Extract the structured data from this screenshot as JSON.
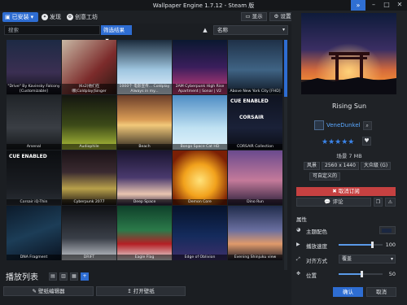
{
  "window": {
    "title": "Wallpaper Engine 1.7.12 - Steam 版"
  },
  "tabs": {
    "installed": "已安装",
    "discover": "发现",
    "workshop": "创意工坊"
  },
  "toolbar": {
    "display": "显示",
    "settings": "设置"
  },
  "search": {
    "placeholder": "搜索"
  },
  "filter": {
    "label": "筛选结果"
  },
  "sort": {
    "value": "名称"
  },
  "grid": {
    "items": [
      "\"Drive\" By Kavinsky Falcony [Customizable]",
      "(Ks2)他们在哪|Coldplay|Singer",
      "1000个 电影宣传... Coldplay Always in my...",
      "2AM Cyberpunk High Rise Apartment | Sonar | V2",
      "Above New York City [FHD]",
      "Arsenal",
      "Audiophile",
      "Beach",
      "Bongo Space Cat HD",
      "CORSAIR Collection",
      "Corsair iQ-Thin",
      "Cyberpunk 2077",
      "Deep Space",
      "Demon Core",
      "Dino Run",
      "DNA Fragment",
      "DRIFT",
      "Eagle Flag",
      "Edge of Oblivion",
      "Evening Shinjuku view"
    ],
    "overlay_cue": "CUE ENABLED",
    "overlay_corsair": "CORSAIR"
  },
  "playlist": {
    "title": "播放列表",
    "editor_button": "壁纸编辑器",
    "open_button": "打开壁纸"
  },
  "details": {
    "title": "Rising Sun",
    "author": "VeneDunkel",
    "rating": 5,
    "size": "场景 7 MB",
    "tags": [
      "风景",
      "2560 x 1440",
      "大众级 (G)"
    ],
    "tag_extra": "可自定义的",
    "unsubscribe": "取消订阅",
    "comment": "评论"
  },
  "properties": {
    "title": "属性",
    "scheme_color": "主题配色",
    "playback_rate": "播放速度",
    "playback_rate_value": "100",
    "alignment": "对齐方式",
    "alignment_value": "覆盖",
    "position": "位置",
    "position_value": "50"
  },
  "footer": {
    "ok": "确认",
    "cancel": "取消"
  },
  "colors": {
    "accent": "#2e6dd2",
    "danger": "#c64141",
    "panel": "#1f2226"
  }
}
